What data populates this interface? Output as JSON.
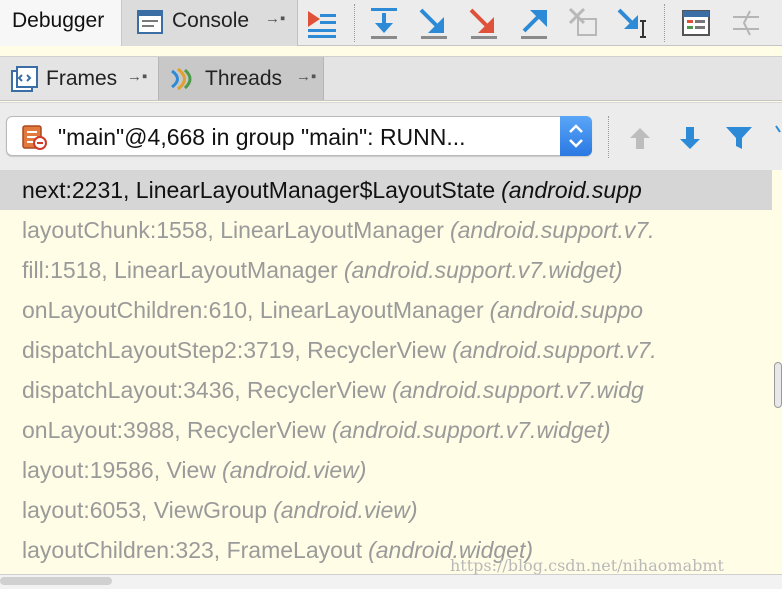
{
  "tabs": {
    "debugger": "Debugger",
    "console": "Console",
    "console_pin": "→▪"
  },
  "subtabs": {
    "frames": "Frames",
    "frames_pin": "→▪",
    "threads": "Threads",
    "threads_pin": "→▪"
  },
  "toolbar_icons": [
    "show-execution-point-icon",
    "step-over-icon",
    "step-into-icon",
    "force-step-into-icon",
    "step-out-icon",
    "drop-frame-icon",
    "run-to-cursor-icon",
    "evaluate-expression-icon",
    "trace-icon"
  ],
  "thread_select": {
    "value": "\"main\"@4,668 in group \"main\": RUNN..."
  },
  "frames": [
    {
      "fn": "next:2231, LinearLayoutManager$LayoutState",
      "pkg": "(android.supp",
      "selected": true
    },
    {
      "fn": "layoutChunk:1558, LinearLayoutManager",
      "pkg": "(android.support.v7."
    },
    {
      "fn": "fill:1518, LinearLayoutManager",
      "pkg": "(android.support.v7.widget)"
    },
    {
      "fn": "onLayoutChildren:610, LinearLayoutManager",
      "pkg": "(android.suppo"
    },
    {
      "fn": "dispatchLayoutStep2:3719, RecyclerView",
      "pkg": "(android.support.v7."
    },
    {
      "fn": "dispatchLayout:3436, RecyclerView",
      "pkg": "(android.support.v7.widg"
    },
    {
      "fn": "onLayout:3988, RecyclerView",
      "pkg": "(android.support.v7.widget)"
    },
    {
      "fn": "layout:19586, View",
      "pkg": "(android.view)"
    },
    {
      "fn": "layout:6053, ViewGroup",
      "pkg": "(android.view)"
    },
    {
      "fn": "layoutChildren:323, FrameLayout",
      "pkg": "(android.widget)"
    }
  ],
  "watermark": "https://blog.csdn.net/nihaomabmt",
  "colors": {
    "frames_background": "#fffde6",
    "selected_row": "#d6d6d6",
    "inactive_text": "#9a9a9a",
    "step_icon_blue": "#2d8ad6",
    "step_icon_red": "#e0513a"
  }
}
